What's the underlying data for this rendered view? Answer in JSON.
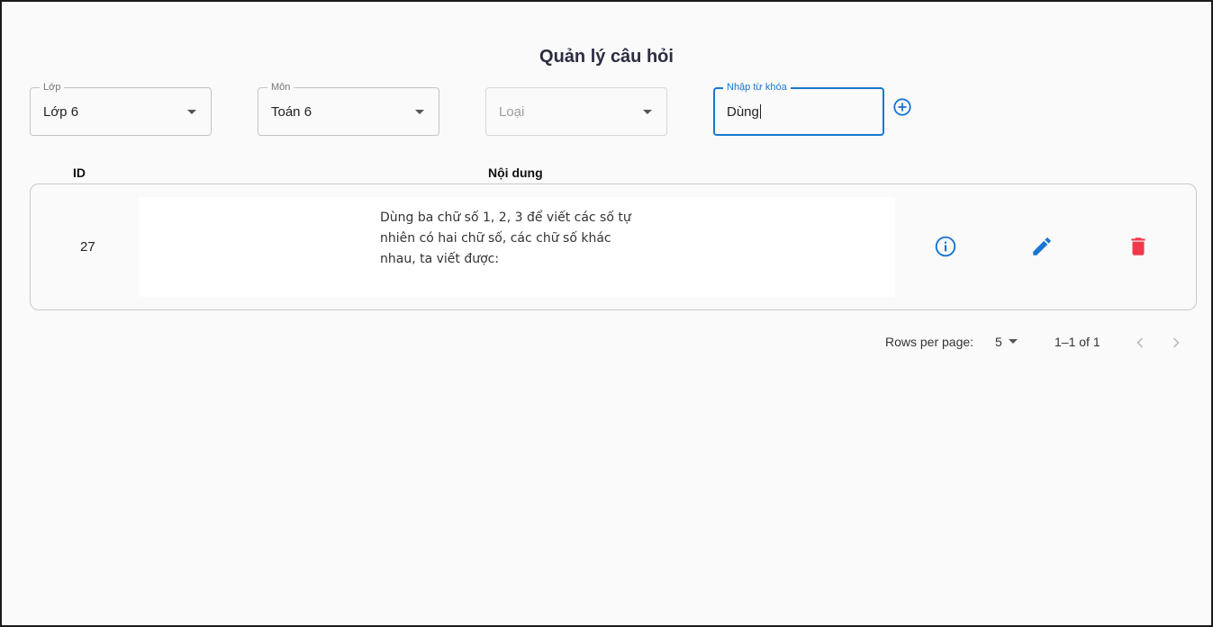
{
  "page": {
    "title": "Quản lý câu hỏi"
  },
  "filters": {
    "class": {
      "label": "Lớp",
      "value": "Lớp 6"
    },
    "subject": {
      "label": "Môn",
      "value": "Toán 6"
    },
    "type": {
      "placeholder": "Loại"
    },
    "keyword": {
      "label": "Nhập từ khóa",
      "value": "Dùng"
    },
    "add_icon": "add-circle-icon"
  },
  "table": {
    "columns": [
      "ID",
      "Nội dung"
    ],
    "rows": [
      {
        "id": "27",
        "content": "Dùng ba chữ số 1, 2, 3 để viết các số tự nhiên có hai chữ số, các chữ số khác nhau, ta viết được:",
        "actions": [
          "info-icon",
          "edit-icon",
          "delete-icon"
        ]
      }
    ]
  },
  "pagination": {
    "rows_per_page_label": "Rows per page:",
    "rows_per_page": "5",
    "range": "1–1 of 1"
  },
  "colors": {
    "accent": "#1976d2",
    "danger": "#f03a4c",
    "title": "#2b2d42"
  }
}
